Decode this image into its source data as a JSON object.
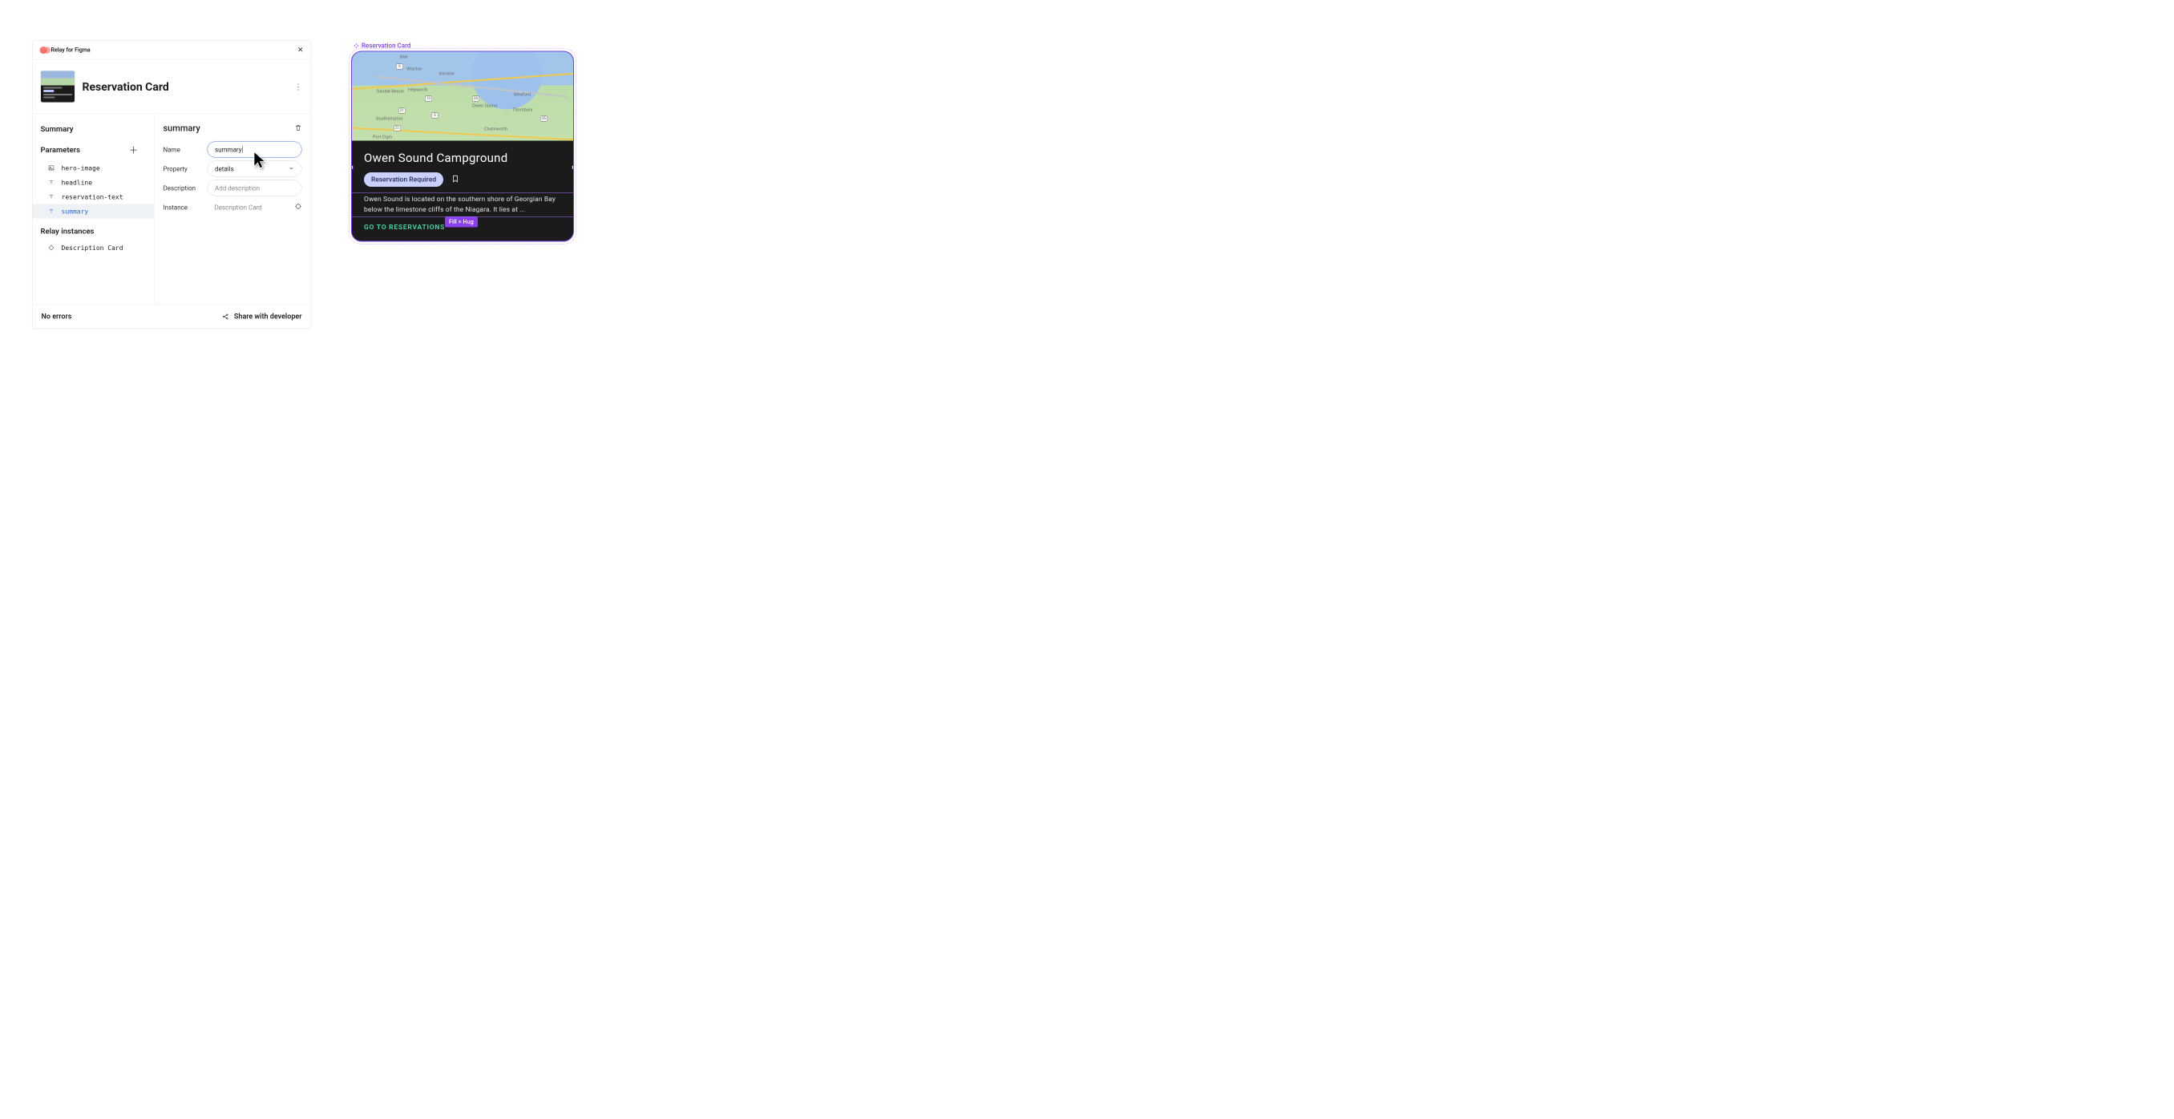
{
  "panel": {
    "app_name": "Relay for Figma",
    "component_name": "Reservation Card",
    "summary_heading": "Summary",
    "parameters_heading": "Parameters",
    "relay_instances_heading": "Relay instances",
    "parameters": {
      "hero_image": "hero-image",
      "headline": "headline",
      "reservation_text": "reservation-text",
      "summary": "summary"
    },
    "instances": {
      "description_card": "Description Card"
    },
    "form": {
      "heading": "summary",
      "name_label": "Name",
      "name_value": "summary",
      "property_label": "Property",
      "property_value": "details",
      "description_label": "Description",
      "description_placeholder": "Add description",
      "instance_label": "Instance",
      "instance_value": "Description Card"
    },
    "footer": {
      "errors": "No errors",
      "share": "Share with developer"
    }
  },
  "preview": {
    "component_label": "Reservation Card",
    "card": {
      "title": "Owen Sound Campground",
      "chip": "Reservation Required",
      "description": "Owen Sound is located on the southern shore of Georgian Bay below the limestone cliffs of the Niagara. It lies at ...",
      "cta": "GO TO RESERVATIONS",
      "size_tag": "Fill × Hug"
    },
    "map_cities": {
      "mar": "Mar",
      "wiarton": "Wiarton",
      "kemble": "Kemble",
      "sauble": "Sauble Beach",
      "hepworth": "Hepworth",
      "owen": "Owen Sound",
      "meaford": "Meaford",
      "thornbury": "Thornbury",
      "southampton": "Southampton",
      "chatsworth": "Chatsworth",
      "portelgin": "Port Elgin"
    },
    "map_hw": {
      "a": "6",
      "b": "21",
      "c": "10",
      "d": "26",
      "e": "26",
      "f": "21",
      "g": "6"
    }
  }
}
